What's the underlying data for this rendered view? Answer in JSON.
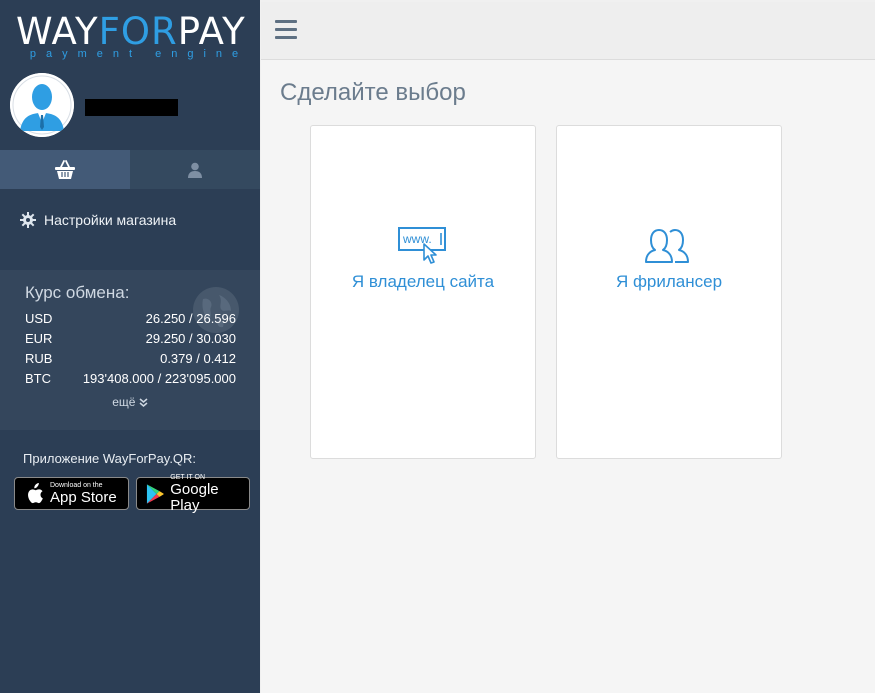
{
  "brand": {
    "logo_prefix": "WAY",
    "logo_accent": "FOR",
    "logo_suffix": "PAY",
    "logo_sub": "payment engine",
    "accent_color": "#2f9ee3"
  },
  "sidebar": {
    "tabs": [
      {
        "icon": "basket-icon",
        "active": true
      },
      {
        "icon": "user-icon",
        "active": false
      }
    ],
    "menu": [
      {
        "icon": "gear-icon",
        "label": "Настройки магазина"
      }
    ],
    "rates": {
      "title": "Курс обмена:",
      "rows": [
        {
          "currency": "USD",
          "value": "26.250 / 26.596"
        },
        {
          "currency": "EUR",
          "value": "29.250 / 30.030"
        },
        {
          "currency": "RUB",
          "value": "0.379 / 0.412"
        },
        {
          "currency": "BTC",
          "value": "193'408.000 / 223'095.000"
        }
      ],
      "more_label": "ещё"
    },
    "app": {
      "title": "Приложение WayForPay.QR:",
      "appstore_small": "Download on the",
      "appstore_big": "App Store",
      "googleplay_small": "GET IT ON",
      "googleplay_big": "Google Play"
    }
  },
  "main": {
    "title": "Сделайте выбор",
    "cards": [
      {
        "icon": "website-icon",
        "label": "Я владелец сайта",
        "icon_text": "www."
      },
      {
        "icon": "users-icon",
        "label": "Я фрилансер"
      }
    ]
  }
}
